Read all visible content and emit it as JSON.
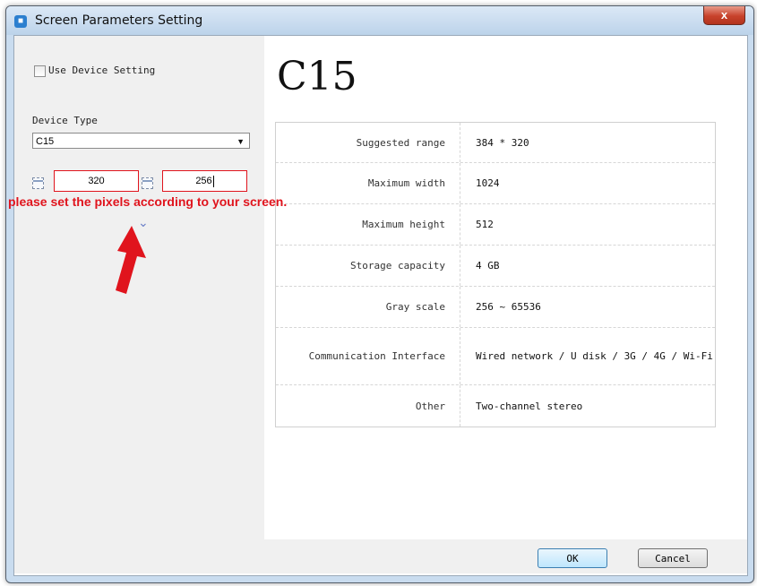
{
  "window": {
    "title": "Screen Parameters Setting",
    "close_glyph": "x"
  },
  "left": {
    "use_device_setting": "Use Device Setting",
    "device_type_label": "Device Type",
    "device_type_value": "C15",
    "width_value": "320",
    "height_value": "256"
  },
  "annotation": {
    "text": "please set the pixels according to your screen.",
    "color": "#e0141d"
  },
  "model": {
    "name": "C15"
  },
  "specs": [
    {
      "key": "Suggested range",
      "value": "384 * 320"
    },
    {
      "key": "Maximum width",
      "value": "1024"
    },
    {
      "key": "Maximum height",
      "value": "512"
    },
    {
      "key": "Storage capacity",
      "value": "4 GB"
    },
    {
      "key": "Gray scale",
      "value": "256 ~ 65536"
    },
    {
      "key": "Communication Interface",
      "value": "Wired network / U disk / 3G / 4G / Wi-Fi"
    },
    {
      "key": "Other",
      "value": "Two-channel stereo"
    }
  ],
  "buttons": {
    "ok": "OK",
    "cancel": "Cancel"
  }
}
